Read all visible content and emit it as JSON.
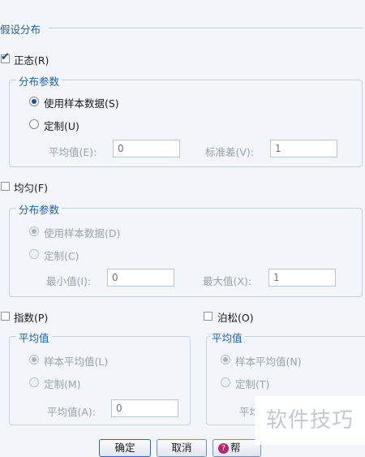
{
  "section": {
    "title": "假设分布"
  },
  "normal": {
    "checkbox_label": "正态(R)",
    "params_title": "分布参数",
    "opt_sample": "使用样本数据(S)",
    "opt_custom": "定制(U)",
    "mean_label": "平均值(E):",
    "mean_value": "0",
    "sd_label": "标准差(V):",
    "sd_value": "1"
  },
  "uniform": {
    "checkbox_label": "均匀(F)",
    "params_title": "分布参数",
    "opt_sample": "使用样本数据(D)",
    "opt_custom": "定制(C)",
    "min_label": "最小值(I):",
    "min_value": "0",
    "max_label": "最大值(X):",
    "max_value": "1"
  },
  "exponential": {
    "checkbox_label": "指数(P)",
    "group_title": "平均值",
    "opt_sample": "样本平均值(L)",
    "opt_custom": "定制(M)",
    "mean_label": "平均值(A):",
    "mean_value": "0"
  },
  "poisson": {
    "checkbox_label": "泊松(O)",
    "group_title": "平均值",
    "opt_sample": "样本平均值(N)",
    "opt_custom": "定制(T)",
    "mean_label_partial": "平均"
  },
  "buttons": {
    "ok": "确定",
    "cancel": "取消",
    "help": "帮"
  },
  "watermark": "软件技巧",
  "icons": {
    "help": "question-icon"
  }
}
